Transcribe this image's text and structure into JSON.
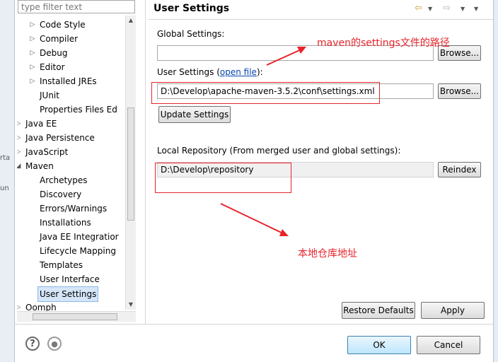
{
  "filter": {
    "placeholder": "type filter text"
  },
  "background": {
    "frag1": "rta",
    "frag2": "un"
  },
  "tree": {
    "items": [
      {
        "label": "Code Style",
        "indent": 2,
        "arrow": "collapsed"
      },
      {
        "label": "Compiler",
        "indent": 2,
        "arrow": "collapsed"
      },
      {
        "label": "Debug",
        "indent": 2,
        "arrow": "collapsed"
      },
      {
        "label": "Editor",
        "indent": 2,
        "arrow": "collapsed"
      },
      {
        "label": "Installed JREs",
        "indent": 2,
        "arrow": "collapsed"
      },
      {
        "label": "JUnit",
        "indent": 2,
        "arrow": "none"
      },
      {
        "label": "Properties Files Ed",
        "indent": 2,
        "arrow": "none"
      },
      {
        "label": "Java EE",
        "indent": 1,
        "arrow": "collapsed"
      },
      {
        "label": "Java Persistence",
        "indent": 1,
        "arrow": "collapsed"
      },
      {
        "label": "JavaScript",
        "indent": 1,
        "arrow": "collapsed"
      },
      {
        "label": "Maven",
        "indent": 1,
        "arrow": "expanded"
      },
      {
        "label": "Archetypes",
        "indent": 2,
        "arrow": "none"
      },
      {
        "label": "Discovery",
        "indent": 2,
        "arrow": "none"
      },
      {
        "label": "Errors/Warnings",
        "indent": 2,
        "arrow": "none"
      },
      {
        "label": "Installations",
        "indent": 2,
        "arrow": "none"
      },
      {
        "label": "Java EE Integratior",
        "indent": 2,
        "arrow": "none"
      },
      {
        "label": "Lifecycle Mapping",
        "indent": 2,
        "arrow": "none"
      },
      {
        "label": "Templates",
        "indent": 2,
        "arrow": "none"
      },
      {
        "label": "User Interface",
        "indent": 2,
        "arrow": "none"
      },
      {
        "label": "User Settings",
        "indent": 2,
        "arrow": "none",
        "selected": true
      },
      {
        "label": "Oomph",
        "indent": 1,
        "arrow": "collapsed"
      }
    ]
  },
  "header": {
    "title": "User Settings"
  },
  "global_settings": {
    "label": "Global Settings:",
    "value": "",
    "browse": "Browse..."
  },
  "user_settings": {
    "label_prefix": "User Settings (",
    "link": "open file",
    "label_suffix": "):",
    "value": "D:\\Develop\\apache-maven-3.5.2\\conf\\settings.xml",
    "browse": "Browse...",
    "update": "Update Settings"
  },
  "local_repo": {
    "label": "Local Repository (From merged user and global settings):",
    "value": "D:\\Develop\\repository",
    "reindex": "Reindex"
  },
  "annotations": {
    "settings_note": "maven的settings文件的路径",
    "repo_note": "本地仓库地址",
    "color": "#e8232a"
  },
  "actions": {
    "restore": "Restore Defaults",
    "apply": "Apply"
  },
  "dialog": {
    "ok": "OK",
    "cancel": "Cancel",
    "help_icon": "?",
    "import_icon": "●"
  }
}
